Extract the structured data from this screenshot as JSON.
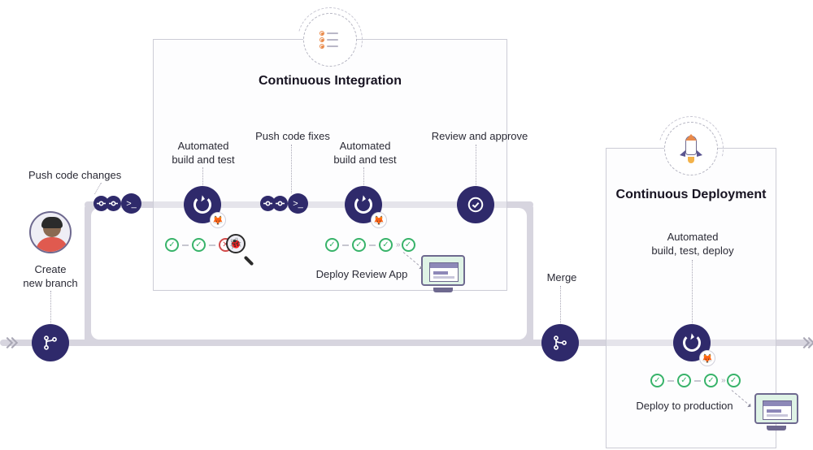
{
  "panels": {
    "ci": {
      "title": "Continuous Integration"
    },
    "cd": {
      "title": "Continuous Deployment"
    }
  },
  "labels": {
    "create_branch": "Create\nnew branch",
    "push_changes": "Push code changes",
    "auto_build_test_1": "Automated\nbuild and test",
    "push_fixes": "Push code fixes",
    "auto_build_test_2": "Automated\nbuild and test",
    "deploy_review_app": "Deploy Review App",
    "review_approve": "Review and approve",
    "merge": "Merge",
    "auto_build_test_deploy": "Automated\nbuild, test, deploy",
    "deploy_production": "Deploy to production"
  },
  "pipeline_steps": {
    "ci_run_1": [
      "pass",
      "pass",
      "fail"
    ],
    "ci_run_2": [
      "pass",
      "pass",
      "pass",
      "pass"
    ],
    "cd_run": [
      "pass",
      "pass",
      "pass",
      "pass"
    ]
  },
  "colors": {
    "node": "#2f2a6b",
    "pass": "#38b36a",
    "fail": "#d24b4b",
    "path": "#d7d5df"
  }
}
